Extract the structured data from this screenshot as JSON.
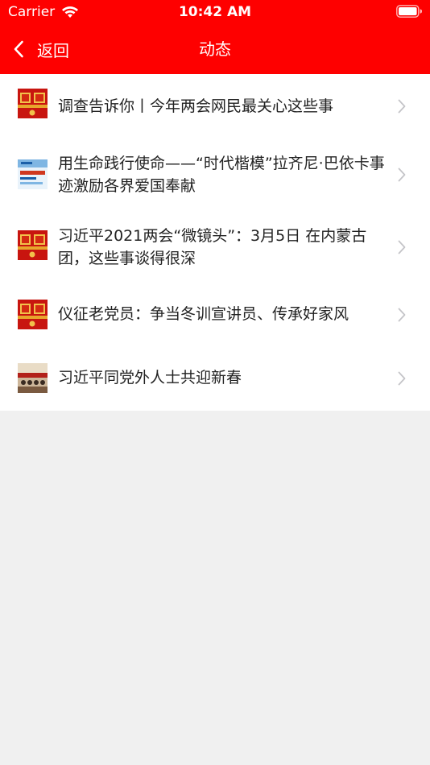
{
  "status_bar": {
    "carrier": "Carrier",
    "time": "10:42 AM",
    "wifi_icon": "wifi-icon",
    "battery_icon": "battery-icon"
  },
  "nav_bar": {
    "back_label": "返回",
    "title": "动态",
    "back_icon": "chevron-left-icon"
  },
  "colors": {
    "brand_red": "#fe0000",
    "background": "#f0f0f0",
    "list_background": "#ffffff",
    "text": "#222222",
    "chevron": "#c4c4c8"
  },
  "news_items": [
    {
      "title": "调查告诉你丨今年两会网民最关心这些事",
      "thumbnail": "red-banner-thumbnail"
    },
    {
      "title": "用生命践行使命——“时代楷模”拉齐尼·巴依卡事迹激励各界爱国奉献",
      "thumbnail": "blue-campaign-thumbnail"
    },
    {
      "title": "习近平2021两会“微镜头”：3月5日 在内蒙古团，这些事谈得很深",
      "thumbnail": "red-banner-thumbnail"
    },
    {
      "title": "仪征老党员：争当冬训宣讲员、传承好家风",
      "thumbnail": "red-banner-thumbnail"
    },
    {
      "title": "习近平同党外人士共迎新春",
      "thumbnail": "meeting-photo-thumbnail"
    }
  ]
}
